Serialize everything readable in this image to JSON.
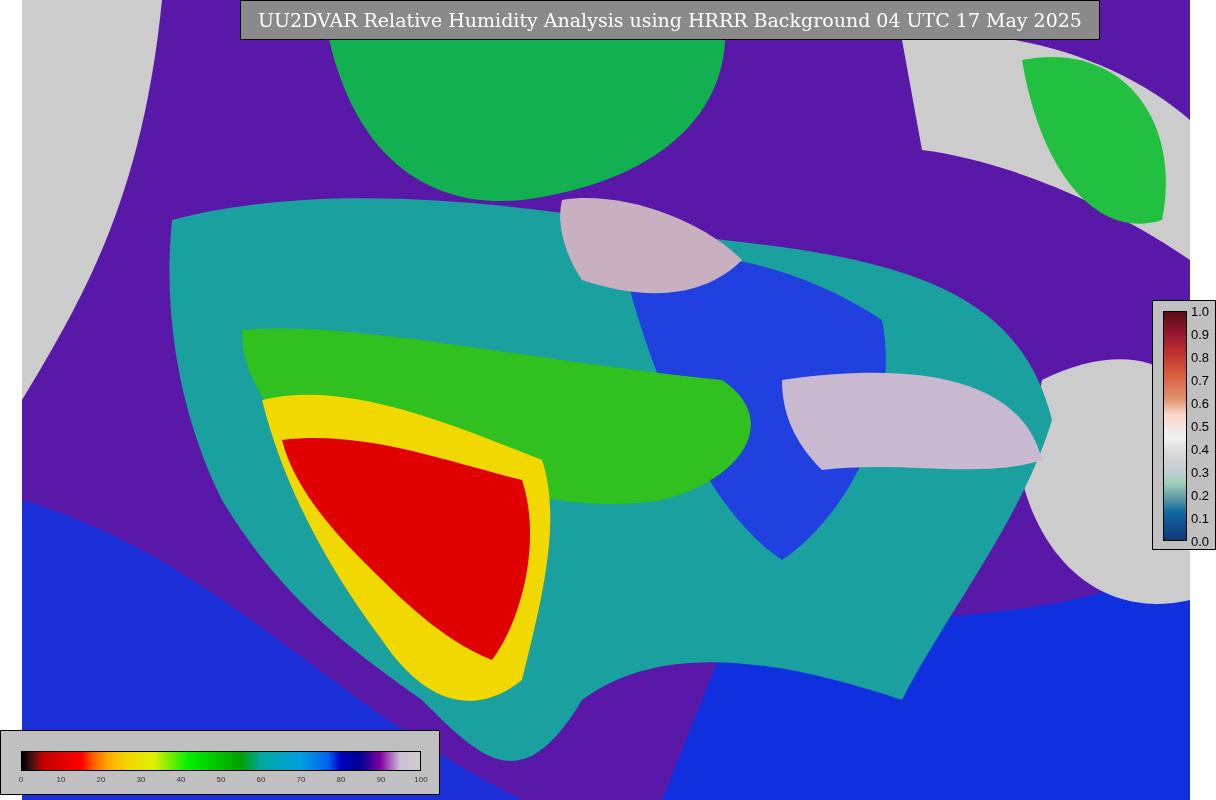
{
  "title": "UU2DVAR Relative Humidity Analysis using HRRR Background 04 UTC 17 May 2025",
  "bottom_colorbar": {
    "ticks": [
      "0",
      "10",
      "20",
      "30",
      "40",
      "50",
      "60",
      "70",
      "80",
      "90",
      "100"
    ]
  },
  "side_colorbar": {
    "ticks": [
      "1.0",
      "0.9",
      "0.8",
      "0.7",
      "0.6",
      "0.5",
      "0.4",
      "0.3",
      "0.2",
      "0.1",
      "0.0"
    ]
  }
}
